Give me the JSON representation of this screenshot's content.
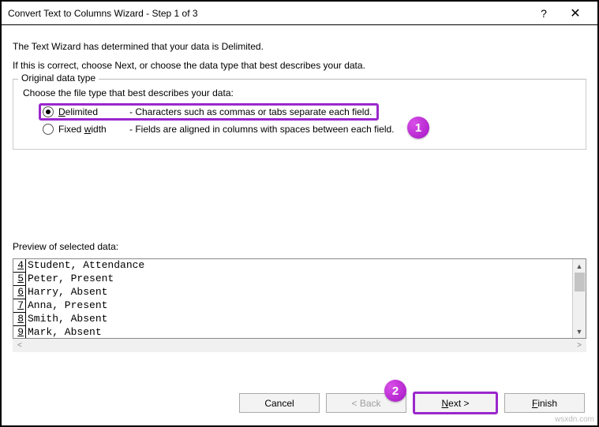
{
  "titlebar": {
    "title": "Convert Text to Columns Wizard - Step 1 of 3",
    "help": "?",
    "close": "✕"
  },
  "intro": {
    "line1": "The Text Wizard has determined that your data is Delimited.",
    "line2": "If this is correct, choose Next, or choose the data type that best describes your data."
  },
  "fieldset": {
    "legend": "Original data type",
    "choose": "Choose the file type that best describes your data:",
    "options": [
      {
        "label_pre": "D",
        "label_rest": "elimited",
        "desc": "- Characters such as commas or tabs separate each field.",
        "selected": true
      },
      {
        "label_pre": "Fixed ",
        "label_under": "w",
        "label_rest": "idth",
        "desc": "- Fields are aligned in columns with spaces between each field.",
        "selected": false
      }
    ]
  },
  "preview": {
    "label": "Preview of selected data:",
    "rows": [
      {
        "n": "4",
        "text": "Student, Attendance"
      },
      {
        "n": "5",
        "text": "Peter, Present"
      },
      {
        "n": "6",
        "text": "Harry, Absent"
      },
      {
        "n": "7",
        "text": "Anna, Present"
      },
      {
        "n": "8",
        "text": "Smith, Absent"
      },
      {
        "n": "9",
        "text": "Mark, Absent"
      }
    ]
  },
  "buttons": {
    "cancel": "Cancel",
    "back": "< Back",
    "next_pre": "N",
    "next_rest": "ext >",
    "finish_pre": "F",
    "finish_rest": "inish"
  },
  "badges": {
    "b1": "1",
    "b2": "2"
  },
  "watermark": "wsxdn.com"
}
